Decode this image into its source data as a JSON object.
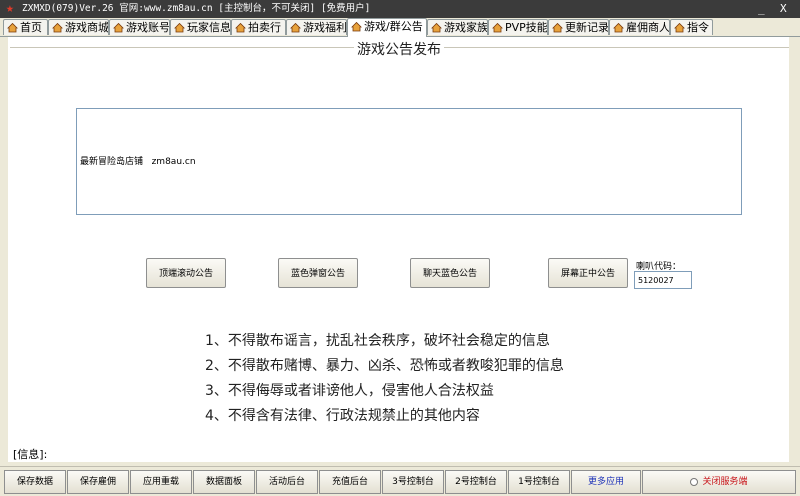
{
  "window": {
    "title": "ZXMXD(079)Ver.26 官网:www.zm8au.cn  [主控制台，不可关闭] [免费用户]",
    "minimize_glyph": "_",
    "close_glyph": "X"
  },
  "tabs": [
    {
      "label": "首页"
    },
    {
      "label": "游戏商城"
    },
    {
      "label": "游戏账号"
    },
    {
      "label": "玩家信息"
    },
    {
      "label": "拍卖行"
    },
    {
      "label": "游戏福利"
    },
    {
      "label": "游戏/群公告",
      "active": true
    },
    {
      "label": "游戏家族"
    },
    {
      "label": "PVP技能"
    },
    {
      "label": "更新记录"
    },
    {
      "label": "雇佣商人"
    },
    {
      "label": "指令"
    }
  ],
  "panel": {
    "group_title": "游戏公告发布",
    "announcement_text": "最新冒险岛店铺   zm8au.cn",
    "buttons": {
      "top_scroll": "顶端滚动公告",
      "blue_popup": "蓝色弹窗公告",
      "chat_blue": "聊天蓝色公告",
      "screen_center": "屏幕正中公告"
    },
    "speaker_label": "喇叭代码：",
    "speaker_code": "5120027",
    "rules": [
      "1、不得散布谣言，扰乱社会秩序，破坏社会稳定的信息",
      "2、不得散布赌博、暴力、凶杀、恐怖或者教唆犯罪的信息",
      "3、不得侮辱或者诽谤他人，侵害他人合法权益",
      "4、不得含有法律、行政法规禁止的其他内容"
    ]
  },
  "info_label": "[信息]:",
  "bottom": {
    "save_data": "保存数据",
    "save_hire": "保存雇佣",
    "apply_reload": "应用重载",
    "data_panel": "数据面板",
    "activity_backend": "活动后台",
    "recharge_backend": "充值后台",
    "console3": "3号控制台",
    "console2": "2号控制台",
    "console1": "1号控制台",
    "more_apps": "更多应用",
    "close_server": "关闭服务端"
  },
  "colors": {
    "more_apps": "#1f33b8",
    "close_server": "#c8151b",
    "title_star": "#e23a2a"
  }
}
